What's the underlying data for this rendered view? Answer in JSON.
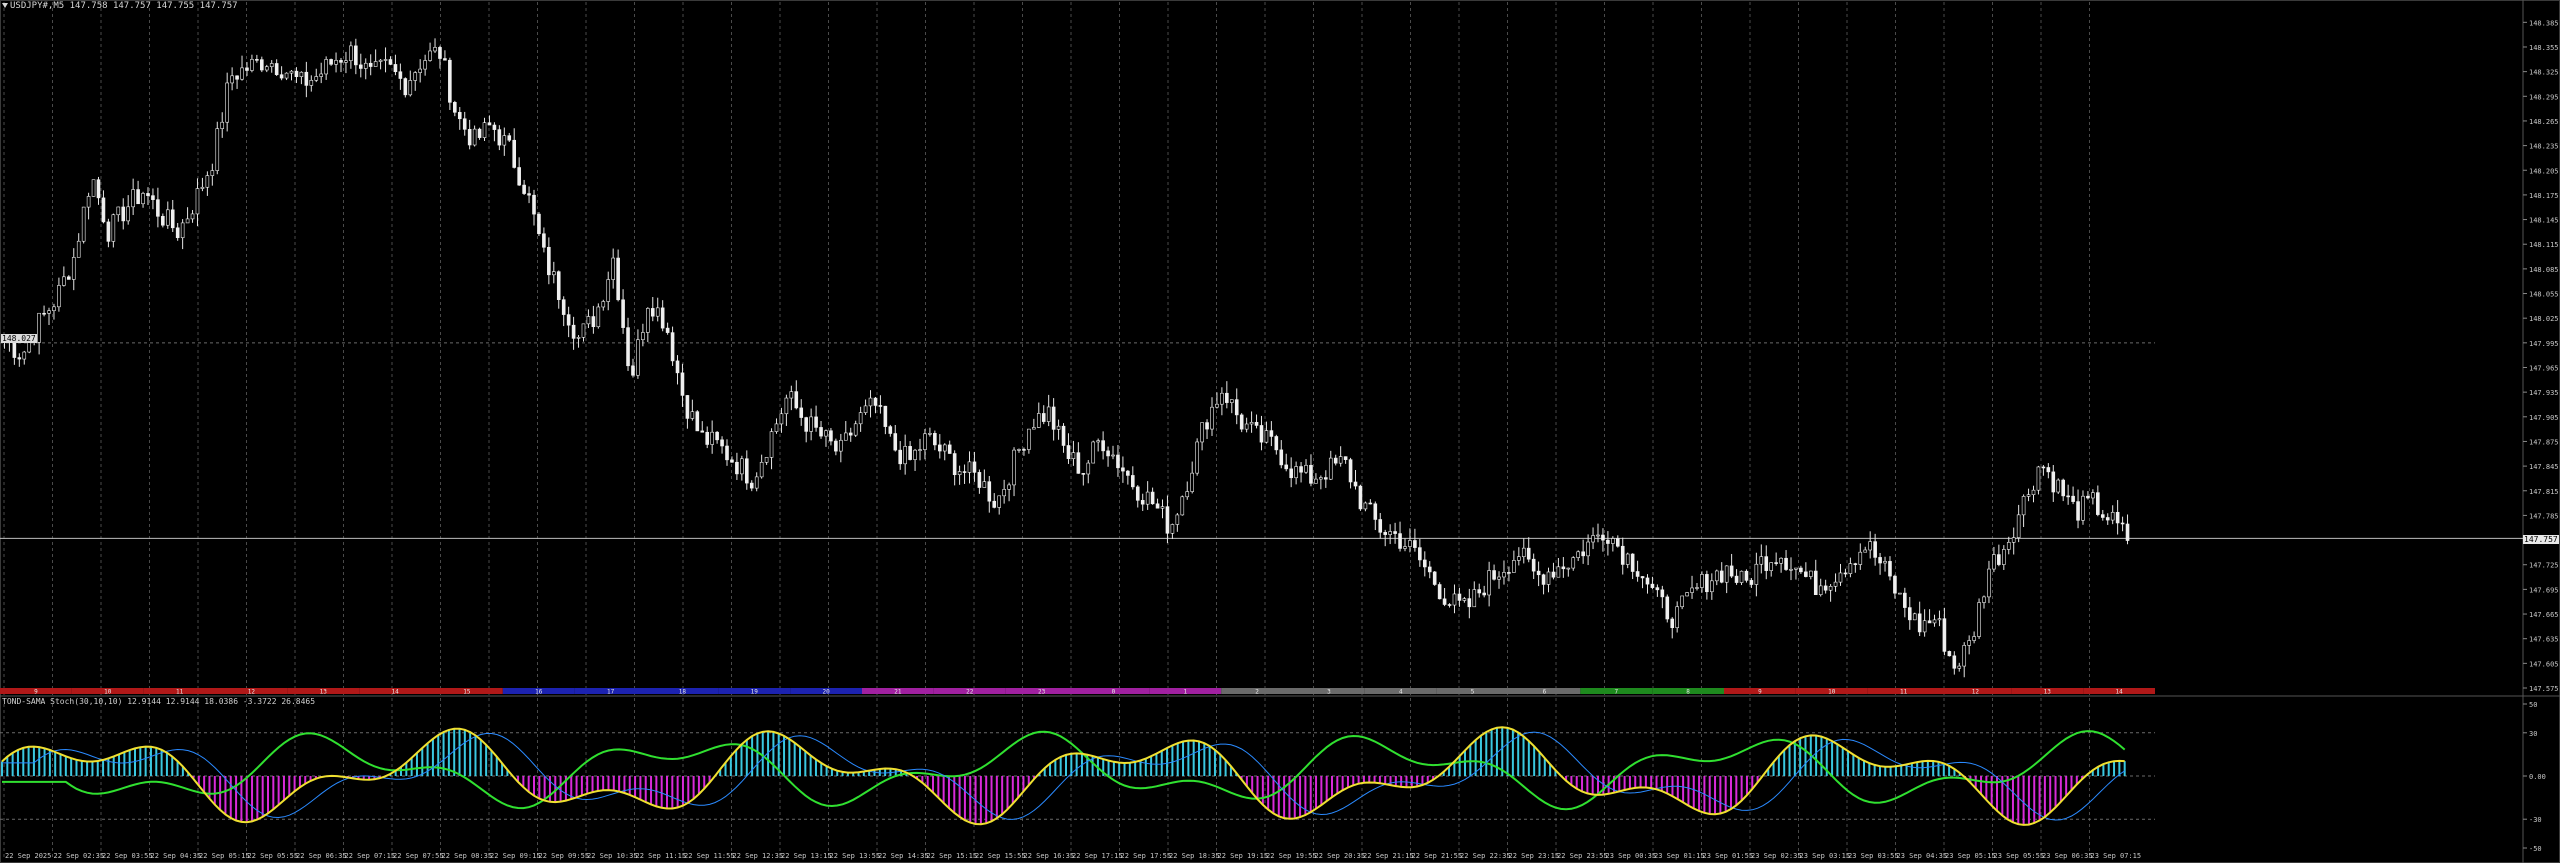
{
  "window": {
    "symbol_label": "USDJPY#,M5  147.758 147.757 147.755 147.757",
    "left_marker": "148.027",
    "current_price_label": "147.757"
  },
  "chart_data": [
    {
      "type": "candlestick",
      "symbol": "USDJPY#",
      "timeframe": "M5",
      "ylim": [
        147.575,
        148.4
      ],
      "y_ticks": [
        "148.385",
        "148.355",
        "148.325",
        "148.295",
        "148.265",
        "148.235",
        "148.205",
        "148.175",
        "148.145",
        "148.115",
        "148.085",
        "148.055",
        "148.025",
        "147.995",
        "147.965",
        "147.935",
        "147.905",
        "147.875",
        "147.845",
        "147.815",
        "147.785",
        "147.755",
        "147.725",
        "147.695",
        "147.665",
        "147.635",
        "147.605",
        "147.575"
      ],
      "current_price": 147.757,
      "dashed_level": 147.995,
      "grid": true,
      "close_series": [
        148.0,
        147.98,
        148.02,
        148.05,
        148.1,
        148.2,
        148.13,
        148.16,
        148.18,
        148.15,
        148.13,
        148.17,
        148.22,
        148.32,
        148.33,
        148.34,
        148.33,
        148.31,
        148.32,
        148.34,
        148.35,
        148.32,
        148.33,
        148.31,
        148.34,
        148.35,
        148.27,
        148.24,
        148.26,
        148.23,
        148.18,
        148.1,
        148.05,
        148.0,
        148.03,
        148.1,
        147.95,
        148.05,
        148.02,
        147.93,
        147.88,
        147.87,
        147.85,
        147.83,
        147.88,
        147.93,
        147.9,
        147.88,
        147.86,
        147.9,
        147.92,
        147.87,
        147.85,
        147.88,
        147.86,
        147.84,
        147.83,
        147.8,
        147.85,
        147.9,
        147.91,
        147.86,
        147.84,
        147.88,
        147.85,
        147.82,
        147.8,
        147.77,
        147.83,
        147.9,
        147.94,
        147.9,
        147.88,
        147.87,
        147.84,
        147.83,
        147.84,
        147.85,
        147.8,
        147.77,
        147.76,
        147.74,
        147.71,
        147.68,
        147.67,
        147.7,
        147.72,
        147.74,
        147.71,
        147.72,
        147.73,
        147.75,
        147.77,
        147.74,
        147.72,
        147.68,
        147.66,
        147.69,
        147.71,
        147.72,
        147.7,
        147.73,
        147.74,
        147.72,
        147.7,
        147.71,
        147.73,
        147.75,
        147.72,
        147.68,
        147.65,
        147.66,
        147.6,
        147.63,
        147.72,
        147.75,
        147.8,
        147.85,
        147.82,
        147.79,
        147.8,
        147.78,
        147.757
      ],
      "time_labels": [
        "22 Sep 2025",
        "22 Sep 02:35",
        "22 Sep 03:55",
        "22 Sep 04:35",
        "22 Sep 05:15",
        "22 Sep 05:55",
        "22 Sep 06:35",
        "22 Sep 07:15",
        "22 Sep 07:55",
        "22 Sep 08:35",
        "22 Sep 09:15",
        "22 Sep 09:55",
        "22 Sep 10:35",
        "22 Sep 11:15",
        "22 Sep 11:55",
        "22 Sep 12:35",
        "22 Sep 13:15",
        "22 Sep 13:55",
        "22 Sep 14:35",
        "22 Sep 15:15",
        "22 Sep 15:55",
        "22 Sep 16:35",
        "22 Sep 17:15",
        "22 Sep 17:55",
        "22 Sep 18:35",
        "22 Sep 19:15",
        "22 Sep 19:55",
        "22 Sep 20:35",
        "22 Sep 21:15",
        "22 Sep 21:55",
        "22 Sep 22:35",
        "22 Sep 23:15",
        "22 Sep 23:55",
        "23 Sep 00:35",
        "23 Sep 01:15",
        "23 Sep 01:55",
        "23 Sep 02:35",
        "23 Sep 03:15",
        "23 Sep 03:55",
        "23 Sep 04:35",
        "23 Sep 05:15",
        "23 Sep 05:55",
        "23 Sep 06:35",
        "23 Sep 07:15"
      ],
      "hour_strip": {
        "labels": [
          "9",
          "10",
          "11",
          "12",
          "13",
          "14",
          "15",
          "16",
          "17",
          "18",
          "19",
          "20",
          "21",
          "22",
          "23",
          "0",
          "1",
          "2",
          "3",
          "4",
          "5",
          "6",
          "7",
          "8",
          "9",
          "10",
          "11",
          "12",
          "13",
          "14"
        ],
        "colors": [
          "#b01818",
          "#b01818",
          "#b01818",
          "#b01818",
          "#b01818",
          "#b01818",
          "#b01818",
          "#1c22b0",
          "#1c22b0",
          "#1c22b0",
          "#1c22b0",
          "#1c22b0",
          "#a020a0",
          "#a020a0",
          "#a020a0",
          "#a020a0",
          "#a020a0",
          "#6a6a6a",
          "#6a6a6a",
          "#6a6a6a",
          "#6a6a6a",
          "#6a6a6a",
          "#1e8a1e",
          "#1e8a1e",
          "#b01818",
          "#b01818",
          "#b01818",
          "#b01818",
          "#b01818",
          "#b01818"
        ]
      }
    },
    {
      "type": "histogram-oscillator",
      "label": "TOND-SAMA Stoch(30,10,10) 12.9144 12.9144 18.0386 -3.3722 26.8465",
      "ylim": [
        -50,
        50
      ],
      "y_ticks": [
        "50",
        "30",
        "0.00",
        "-30",
        "-50"
      ],
      "dashed_levels": [
        30,
        0,
        -30
      ],
      "colors": {
        "positive": "#3ac8e0",
        "negative": "#d82ad8",
        "main": "#f0e030",
        "signal": "#2a8aff",
        "band": "#30e030"
      }
    }
  ]
}
